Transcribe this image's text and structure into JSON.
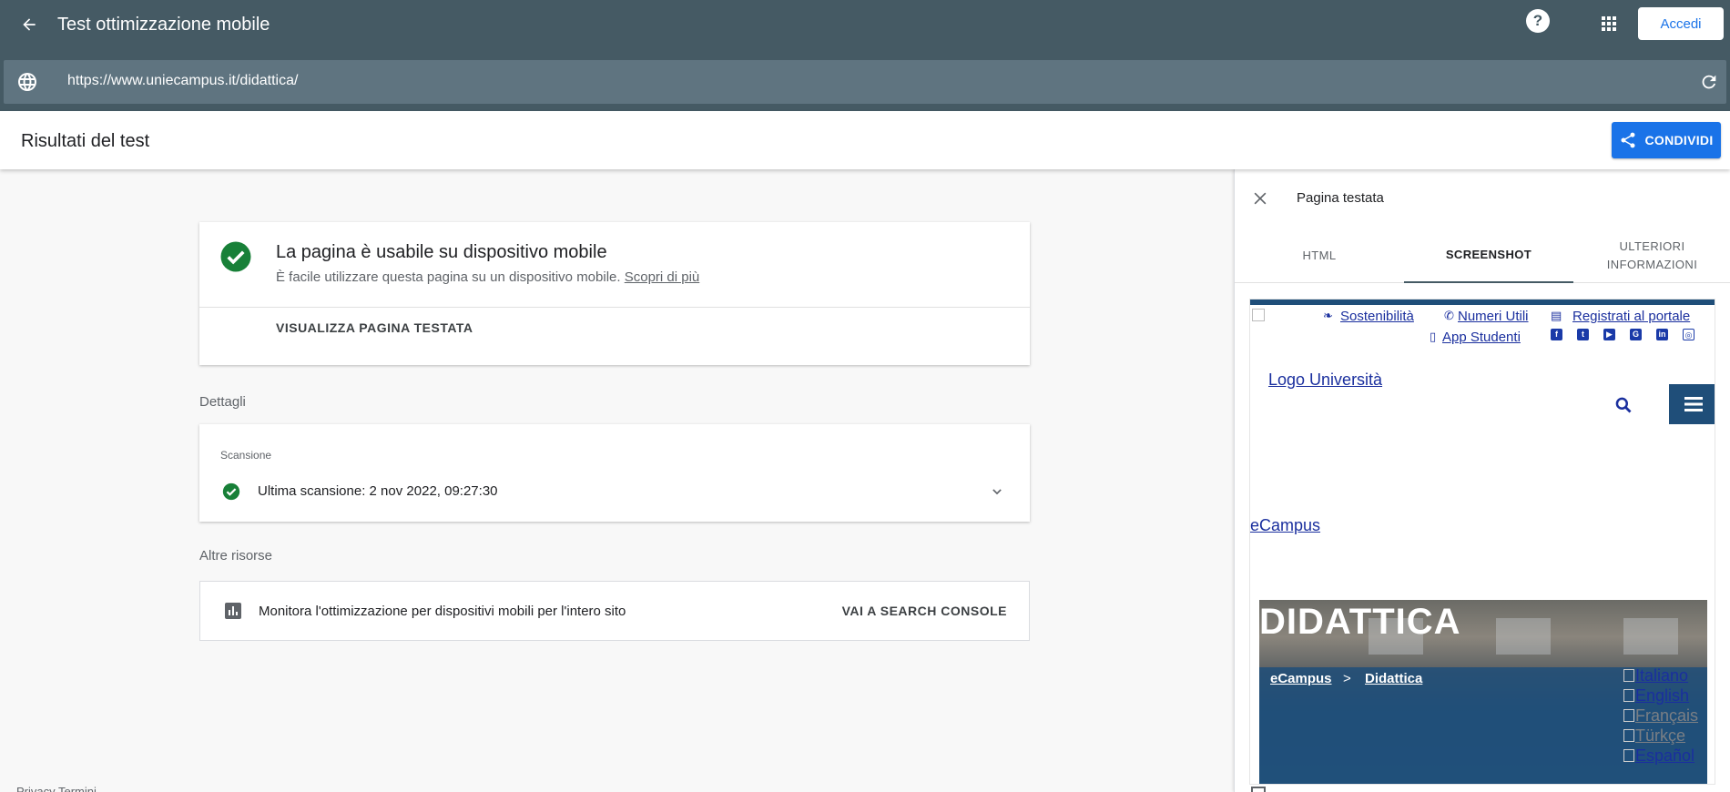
{
  "header": {
    "title": "Test ottimizzazione mobile",
    "help_label": "?",
    "signin_label": "Accedi"
  },
  "urlbar": {
    "url": "https://www.uniecampus.it/didattica/"
  },
  "results": {
    "title": "Risultati del test",
    "share_label": "CONDIVIDI"
  },
  "main_card": {
    "headline": "La pagina è usabile su dispositivo mobile",
    "subtext": "È facile utilizzare questa pagina su un dispositivo mobile. ",
    "learn_more": "Scopri di più",
    "view_page_label": "VISUALIZZA PAGINA TESTATA"
  },
  "details": {
    "section_label": "Dettagli",
    "scan_label": "Scansione",
    "last_scan": "Ultima scansione: 2 nov 2022, 09:27:30"
  },
  "resources": {
    "section_label": "Altre risorse",
    "monitor_text": "Monitora l'ottimizzazione per dispositivi mobili per l'intero sito",
    "console_label": "VAI A SEARCH CONSOLE"
  },
  "footer": {
    "links": "Privacy   Termini"
  },
  "panel": {
    "title": "Pagina testata",
    "tabs": [
      {
        "label": "HTML"
      },
      {
        "label": "SCREENSHOT"
      },
      {
        "label": "ULTERIORI INFORMAZIONI"
      }
    ]
  },
  "preview": {
    "sostenibilita": "Sostenibilità",
    "numeri_utili": "Numeri Utili",
    "registrati": "Registrati al portale",
    "app_studenti": "App Studenti",
    "logo": "Logo Università",
    "ecampus": "eCampus",
    "hero_title": "DIDATTICA",
    "crumb_home": "eCampus",
    "crumb_sep": ">",
    "crumb_current": "Didattica",
    "languages": [
      "Italiano",
      "English",
      "Français",
      "Türkçe",
      "Español"
    ]
  },
  "colors": {
    "header_bg": "#455a64",
    "accent": "#1a73e8",
    "success": "#188038"
  }
}
